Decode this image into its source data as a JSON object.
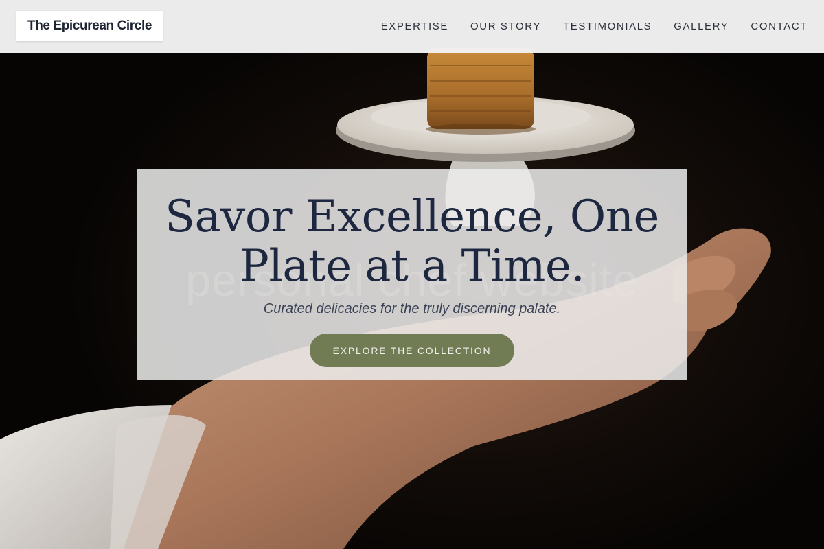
{
  "header": {
    "logo": "The Epicurean Circle",
    "nav": [
      {
        "label": "EXPERTISE"
      },
      {
        "label": "OUR STORY"
      },
      {
        "label": "TESTIMONIALS"
      },
      {
        "label": "GALLERY"
      },
      {
        "label": "CONTACT"
      }
    ]
  },
  "hero": {
    "title": "Savor Excellence, One\nPlate at a Time.",
    "ghost_text": "personal chef website",
    "subtitle": "Curated delicacies for the truly discerning palate.",
    "cta_label": "EXPLORE THE COLLECTION",
    "image": "chef-hand-serving-plate-photo"
  },
  "colors": {
    "header_bg": "#f3f3f3",
    "title": "#1d2840",
    "cta_bg": "#717c55",
    "cta_text": "#f3f1ea"
  }
}
